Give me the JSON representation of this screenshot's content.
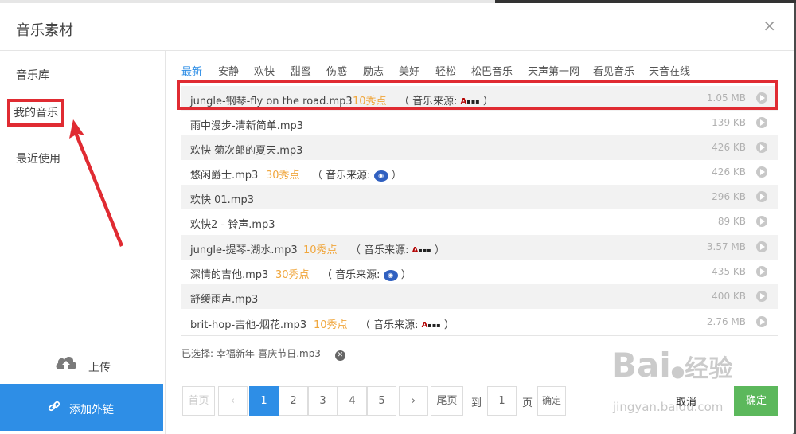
{
  "dialog": {
    "title": "音乐素材",
    "close_label": "×"
  },
  "sidebar": {
    "items": [
      {
        "label": "音乐库"
      },
      {
        "label": "我的音乐"
      },
      {
        "label": "最近使用"
      }
    ],
    "upload_label": "上传",
    "ext_link_label": "添加外链"
  },
  "tabs": [
    "最新",
    "安静",
    "欢快",
    "甜蜜",
    "伤感",
    "励志",
    "美好",
    "轻松",
    "松巴音乐",
    "天声第一网",
    "看见音乐",
    "天音在线"
  ],
  "tracks": [
    {
      "name": "jungle-钢琴-fly on the road.mp3",
      "points": "10秀点",
      "source": "（ 音乐来源:",
      "source_end": "）",
      "size": "1.05 MB"
    },
    {
      "name": "雨中漫步-清新简单.mp3",
      "size": "139 KB"
    },
    {
      "name": "欢快 菊次郎的夏天.mp3",
      "size": "426 KB"
    },
    {
      "name": "悠闲爵士.mp3",
      "points": "30秀点",
      "source": "（ 音乐来源:",
      "source_end": "）",
      "size": "426 KB"
    },
    {
      "name": "欢快 01.mp3",
      "size": "296 KB"
    },
    {
      "name": "欢快2 - 铃声.mp3",
      "size": "89 KB"
    },
    {
      "name": "jungle-提琴-湖水.mp3",
      "points": "10秀点",
      "source": "（ 音乐来源:",
      "source_end": "）",
      "size": "3.57 MB"
    },
    {
      "name": "深情的吉他.mp3",
      "points": "30秀点",
      "source": "（ 音乐来源:",
      "source_end": "）",
      "size": "435 KB"
    },
    {
      "name": "舒缓雨声.mp3",
      "size": "400 KB"
    },
    {
      "name": "brit-hop-吉他-烟花.mp3",
      "points": "10秀点",
      "source": "（ 音乐来源:",
      "source_end": "）",
      "size": "2.76 MB"
    }
  ],
  "selected_text": "已选择: 幸福新年-喜庆节日.mp3",
  "pagination": {
    "first": "首页",
    "prev": "‹",
    "pages": [
      "1",
      "2",
      "3",
      "4",
      "5"
    ],
    "next": "›",
    "last": "尾页",
    "goto_prefix": "到",
    "goto_value": "1",
    "goto_suffix": "页",
    "goto_button": "确定"
  },
  "actions": {
    "cancel": "取消",
    "confirm": "确定"
  },
  "watermark": {
    "brand": "Bai",
    "brand_cn": "经验",
    "url": "jingyan.baidu.com"
  },
  "colors": {
    "accent": "#2e8ee6",
    "highlight": "#e02b32",
    "points": "#f0a63c",
    "confirm": "#5cb85c"
  }
}
